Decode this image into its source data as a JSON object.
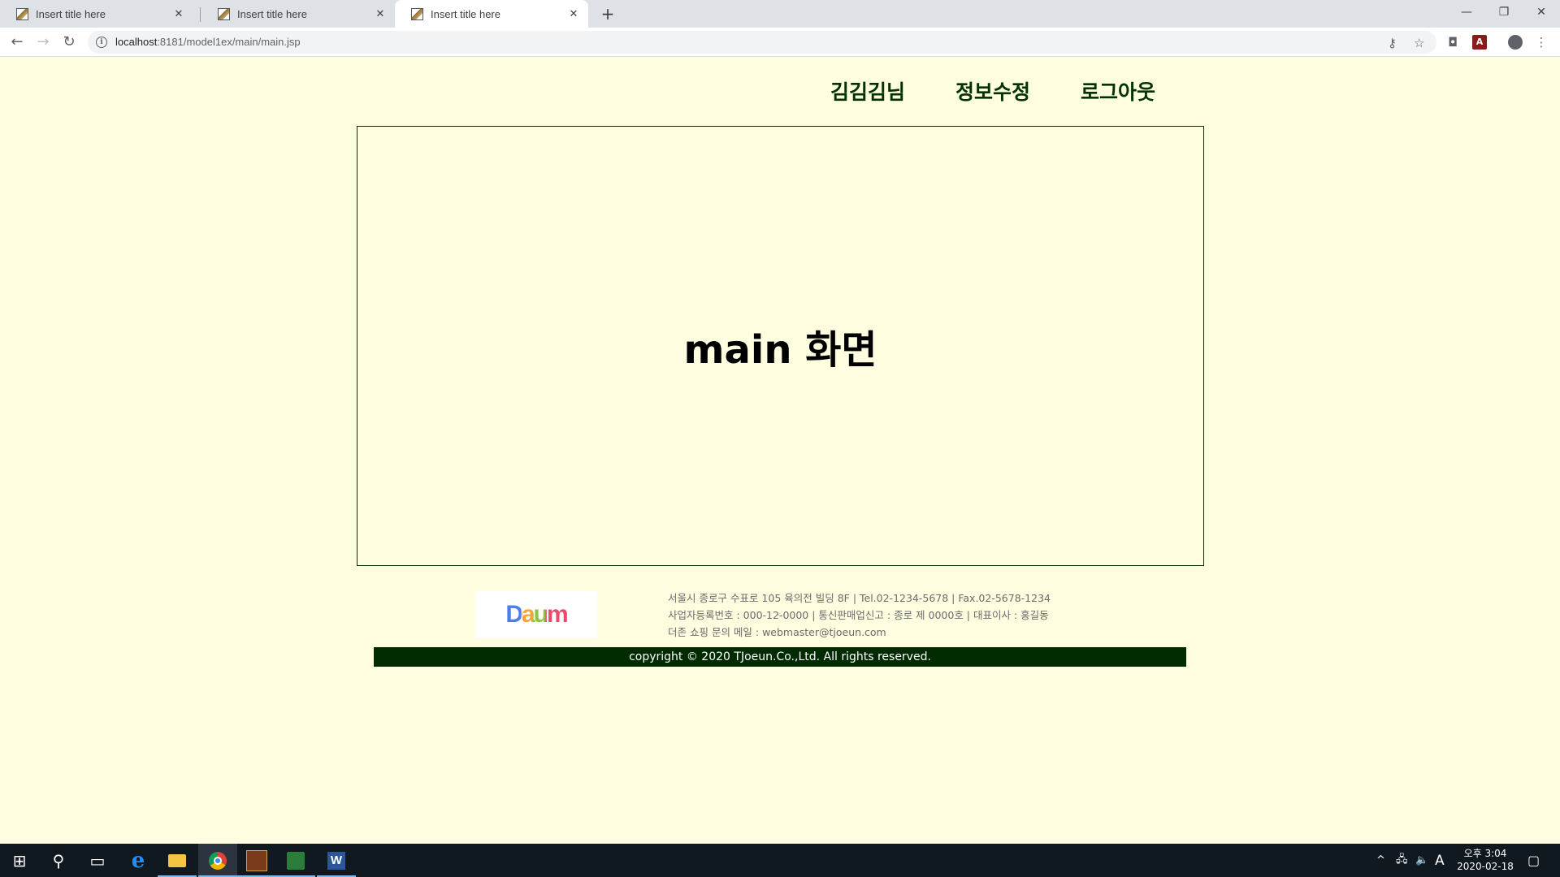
{
  "browser": {
    "tabs": [
      {
        "title": "Insert title here",
        "active": false
      },
      {
        "title": "Insert title here",
        "active": false
      },
      {
        "title": "Insert title here",
        "active": true
      }
    ],
    "url_host": "localhost",
    "url_path": ":8181/model1ex/main/main.jsp"
  },
  "page": {
    "menu": [
      "김김김님",
      "정보수정",
      "로그아웃"
    ],
    "main_heading": "main 화면",
    "footer": {
      "logo_text": "Daum",
      "address_line": "서울시 종로구 수표로 105 육의전 빌딩 8F | Tel.02-1234-5678 | Fax.02-5678-1234",
      "business_line": "사업자등록번호 : 000-12-0000 | 통신판매업신고 : 종로 제 0000호 | 대표이사 : 홍길동",
      "email_line": "더존 쇼핑 문의 메일 : webmaster@tjoeun.com",
      "copyright": "copyright © 2020 TJoeun.Co.,Ltd. All rights reserved."
    },
    "colors": {
      "background": "#fffde0",
      "accent": "#003300",
      "footer_bar": "#002b00"
    }
  },
  "taskbar": {
    "apps": [
      "windows-start",
      "search",
      "task-view",
      "edge",
      "file-explorer",
      "chrome",
      "game-app",
      "media-app",
      "word"
    ],
    "clock_time": "오후 3:04",
    "clock_date": "2020-02-18",
    "ime": "A"
  }
}
